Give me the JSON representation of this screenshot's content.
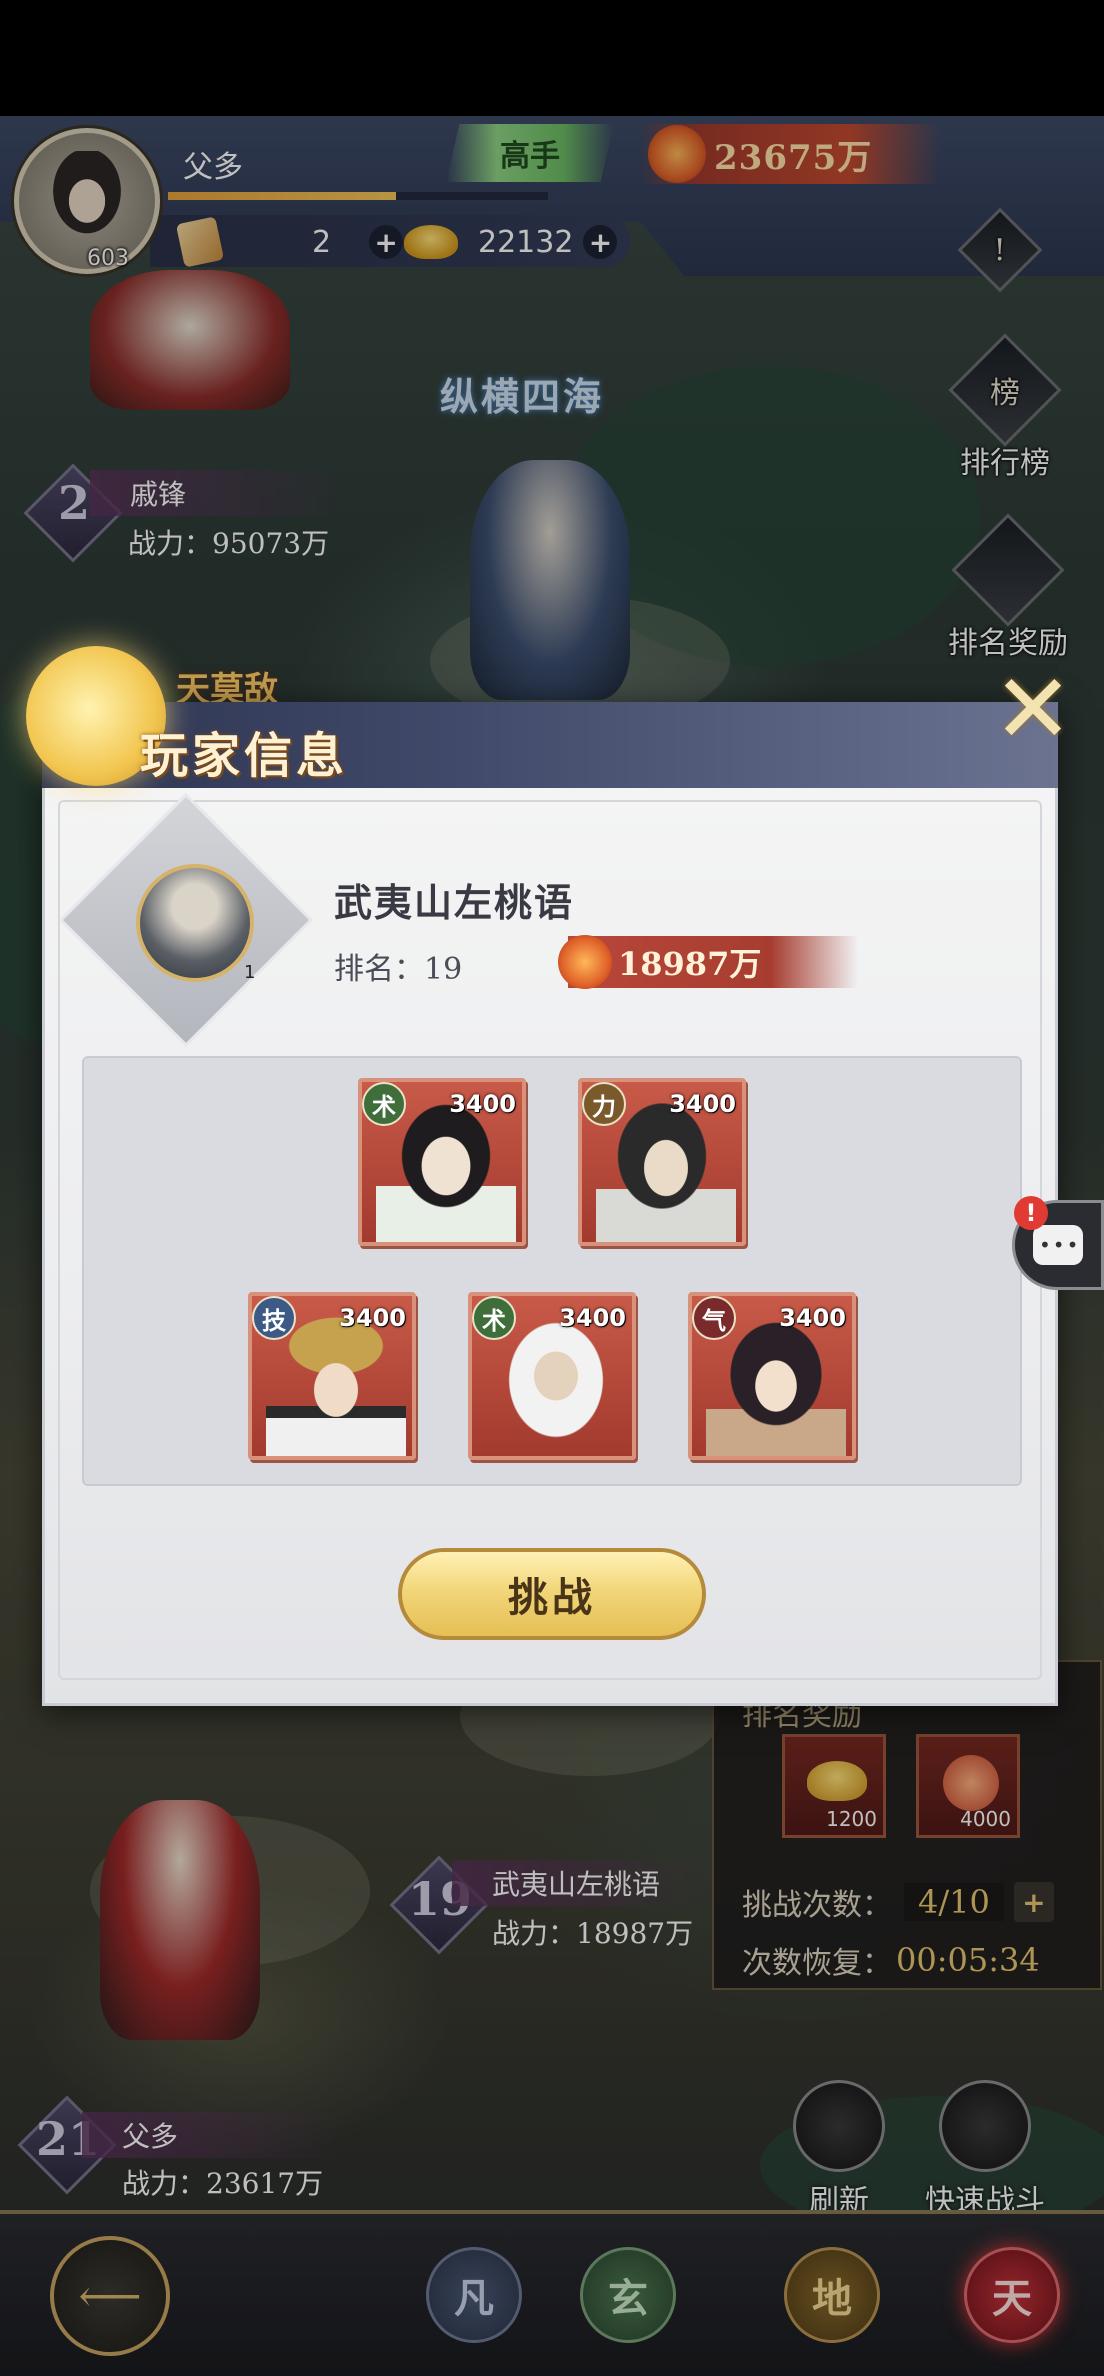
{
  "hud": {
    "player_name": "父多",
    "level": "603",
    "xp_fraction": 0.6,
    "rank_tier": "高手",
    "power": "23675万",
    "tickets": "2",
    "gold": "22132",
    "plus": "+"
  },
  "side": {
    "alert": "!",
    "leaderboard_glyph": "榜",
    "leaderboard": "排行榜",
    "rank_reward": "排名奖励"
  },
  "scene": {
    "banner": "纵横四海",
    "top_entry": {
      "rank": "2",
      "name": "戚锋",
      "power": "战力：95073万"
    },
    "mid_entry": {
      "rank": "19",
      "name": "武夷山左桃语",
      "power": "战力：18987万"
    },
    "self_entry": {
      "rank": "21",
      "name": "父多",
      "power": "战力：23617万"
    },
    "tag": "天莫敌"
  },
  "info_panel": {
    "title": "排名奖励",
    "rewards": [
      {
        "count": "1200"
      },
      {
        "count": "4000"
      }
    ],
    "attempts_label": "挑战次数：",
    "attempts_value": "4/10",
    "recover_label": "次数恢复：",
    "recover_value": "00:05:34"
  },
  "actions": {
    "refresh": "刷新",
    "quick_battle": "快速战斗"
  },
  "nav": {
    "tabs": [
      "凡",
      "玄",
      "地",
      "天"
    ]
  },
  "modal": {
    "title": "玩家信息",
    "close": "✕",
    "opponent": {
      "name": "武夷山左桃语",
      "level": "1",
      "rank_label": "排名：",
      "rank_value": "19",
      "power": "18987万"
    },
    "heroes": [
      {
        "type": "术",
        "power": "3400",
        "type_color": "#3f6e3a"
      },
      {
        "type": "力",
        "power": "3400",
        "type_color": "#7a5a2a"
      },
      {
        "type": "技",
        "power": "3400",
        "type_color": "#3d5a86"
      },
      {
        "type": "术",
        "power": "3400",
        "type_color": "#3f6e3a"
      },
      {
        "type": "气",
        "power": "3400",
        "type_color": "#7a2a2a"
      }
    ],
    "challenge": "挑战"
  },
  "chat": {
    "alert": "!",
    "dots": "•••"
  }
}
